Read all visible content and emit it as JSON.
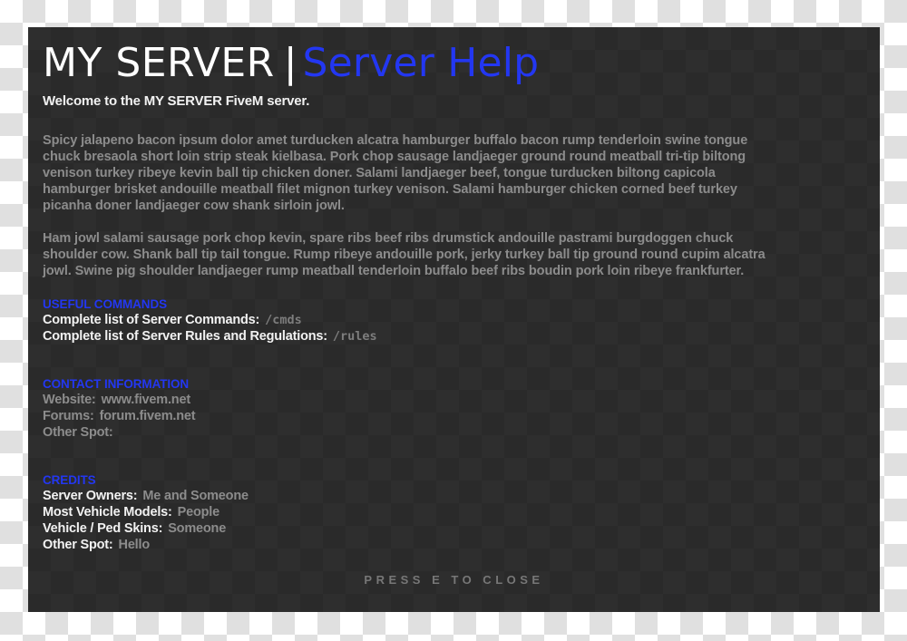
{
  "panel": {
    "title": {
      "main": "MY SERVER",
      "separator": "|",
      "accent": "Server Help"
    },
    "welcome": "Welcome to the MY SERVER FiveM server.",
    "paragraphs": [
      "Spicy jalapeno bacon ipsum dolor amet turducken alcatra hamburger buffalo bacon rump tenderloin swine tongue chuck bresaola short loin strip steak kielbasa. Pork chop sausage landjaeger ground round meatball tri-tip biltong venison turkey ribeye kevin ball tip chicken doner. Salami landjaeger beef, tongue turducken biltong capicola hamburger brisket andouille meatball filet mignon turkey venison. Salami hamburger chicken corned beef turkey picanha doner landjaeger cow shank sirloin jowl.",
      "Ham jowl salami sausage pork chop kevin, spare ribs beef ribs drumstick andouille pastrami burgdoggen chuck shoulder cow. Shank ball tip tail tongue. Rump ribeye andouille pork, jerky turkey ball tip ground round cupim alcatra jowl. Swine pig shoulder landjaeger rump meatball tenderloin buffalo beef ribs boudin pork loin ribeye frankfurter."
    ],
    "sections": {
      "commands": {
        "heading": "USEFUL COMMANDS",
        "rows": [
          {
            "label": "Complete list of Server Commands:",
            "value": "/cmds"
          },
          {
            "label": "Complete list of Server Rules and Regulations:",
            "value": "/rules"
          }
        ]
      },
      "contact": {
        "heading": "CONTACT INFORMATION",
        "rows": [
          {
            "label": "Website:",
            "value": "www.fivem.net"
          },
          {
            "label": "Forums:",
            "value": "forum.fivem.net"
          },
          {
            "label": "Other Spot:",
            "value": ""
          }
        ]
      },
      "credits": {
        "heading": "CREDITS",
        "rows": [
          {
            "label": "Server Owners:",
            "value": "Me and Someone"
          },
          {
            "label": "Most Vehicle Models:",
            "value": "People"
          },
          {
            "label": "Vehicle / Ped Skins:",
            "value": "Someone"
          },
          {
            "label": "Other Spot:",
            "value": "Hello"
          }
        ]
      }
    },
    "footer_hint": "PRESS E TO CLOSE"
  },
  "colors": {
    "accent_blue": "#2337f2",
    "body_gray": "#8c8c8c",
    "label_white": "#f2f2f2",
    "panel_dark": "#2e2e2e",
    "footer_gray": "#777777"
  }
}
